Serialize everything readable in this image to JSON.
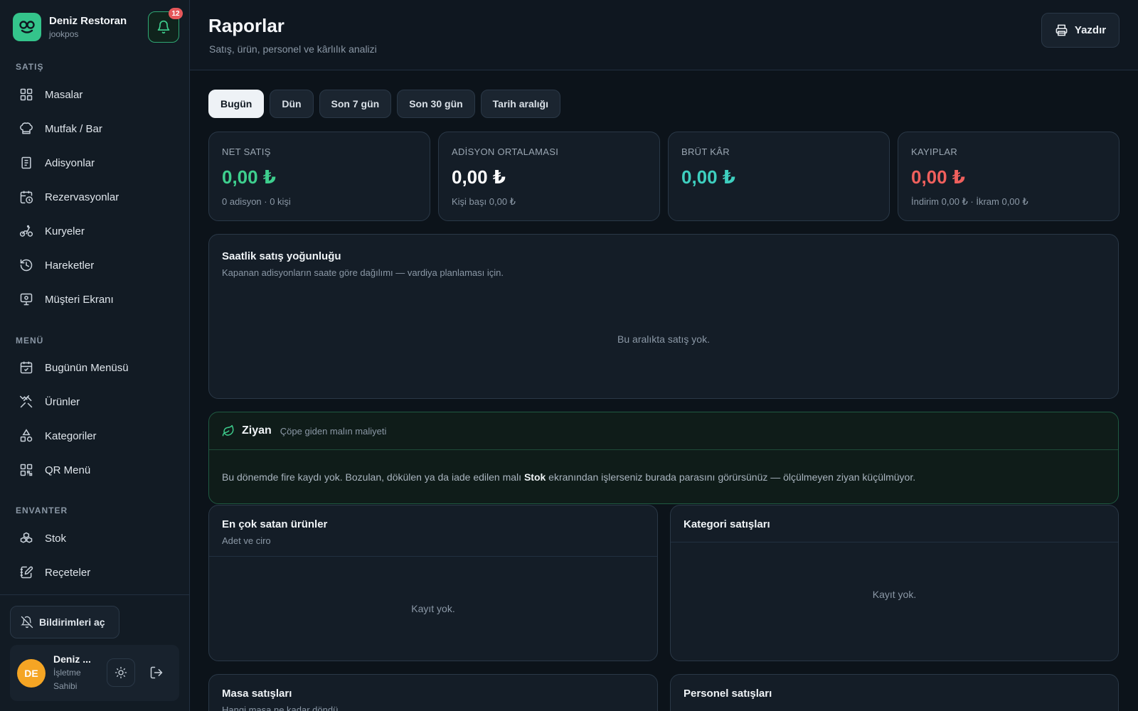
{
  "brand": {
    "name": "Deniz Restoran",
    "sub": "jookpos"
  },
  "notifications": {
    "count": "12"
  },
  "sidebar": {
    "sections": [
      {
        "title": "SATIŞ",
        "items": [
          "Masalar",
          "Mutfak / Bar",
          "Adisyonlar",
          "Rezervasyonlar",
          "Kuryeler",
          "Hareketler",
          "Müşteri Ekranı"
        ]
      },
      {
        "title": "MENÜ",
        "items": [
          "Bugünün Menüsü",
          "Ürünler",
          "Kategoriler",
          "QR Menü"
        ]
      },
      {
        "title": "ENVANTER",
        "items": [
          "Stok",
          "Reçeteler"
        ]
      }
    ],
    "notif_button": "Bildirimleri aç"
  },
  "user": {
    "initials": "DE",
    "name": "Deniz ...",
    "role": "İşletme Sahibi"
  },
  "header": {
    "title": "Raporlar",
    "subtitle": "Satış, ürün, personel ve kârlılık analizi",
    "print": "Yazdır"
  },
  "tabs": [
    "Bugün",
    "Dün",
    "Son 7 gün",
    "Son 30 gün",
    "Tarih aralığı"
  ],
  "stats": [
    {
      "label": "NET SATIŞ",
      "value": "0,00 ₺",
      "note": "0 adisyon · 0 kişi",
      "color": "#3ecf8e"
    },
    {
      "label": "ADİSYON ORTALAMASI",
      "value": "0,00 ₺",
      "note": "Kişi başı 0,00 ₺",
      "color": "#ffffff"
    },
    {
      "label": "BRÜT KÂR",
      "value": "0,00 ₺",
      "note": "",
      "color": "#3ecfbf"
    },
    {
      "label": "KAYIPLAR",
      "value": "0,00 ₺",
      "note": "İndirim 0,00 ₺ · İkram 0,00 ₺",
      "color": "#f0605d"
    }
  ],
  "hourly": {
    "title": "Saatlik satış yoğunluğu",
    "subtitle": "Kapanan adisyonların saate göre dağılımı — vardiya planlaması için.",
    "empty": "Bu aralıkta satış yok."
  },
  "waste": {
    "title": "Ziyan",
    "subtitle": "Çöpe giden malın maliyeti",
    "body_pre": "Bu dönemde fire kaydı yok. Bozulan, dökülen ya da iade edilen malı ",
    "body_bold": "Stok",
    "body_post": " ekranından işlerseniz burada parasını görürsünüz — ölçülmeyen ziyan küçülmüyor."
  },
  "top_products": {
    "title": "En çok satan ürünler",
    "subtitle": "Adet ve ciro",
    "empty": "Kayıt yok."
  },
  "category_sales": {
    "title": "Kategori satışları",
    "empty": "Kayıt yok."
  },
  "table_sales": {
    "title": "Masa satışları",
    "subtitle": "Hangi masa ne kadar döndü"
  },
  "staff_sales": {
    "title": "Personel satışları"
  }
}
